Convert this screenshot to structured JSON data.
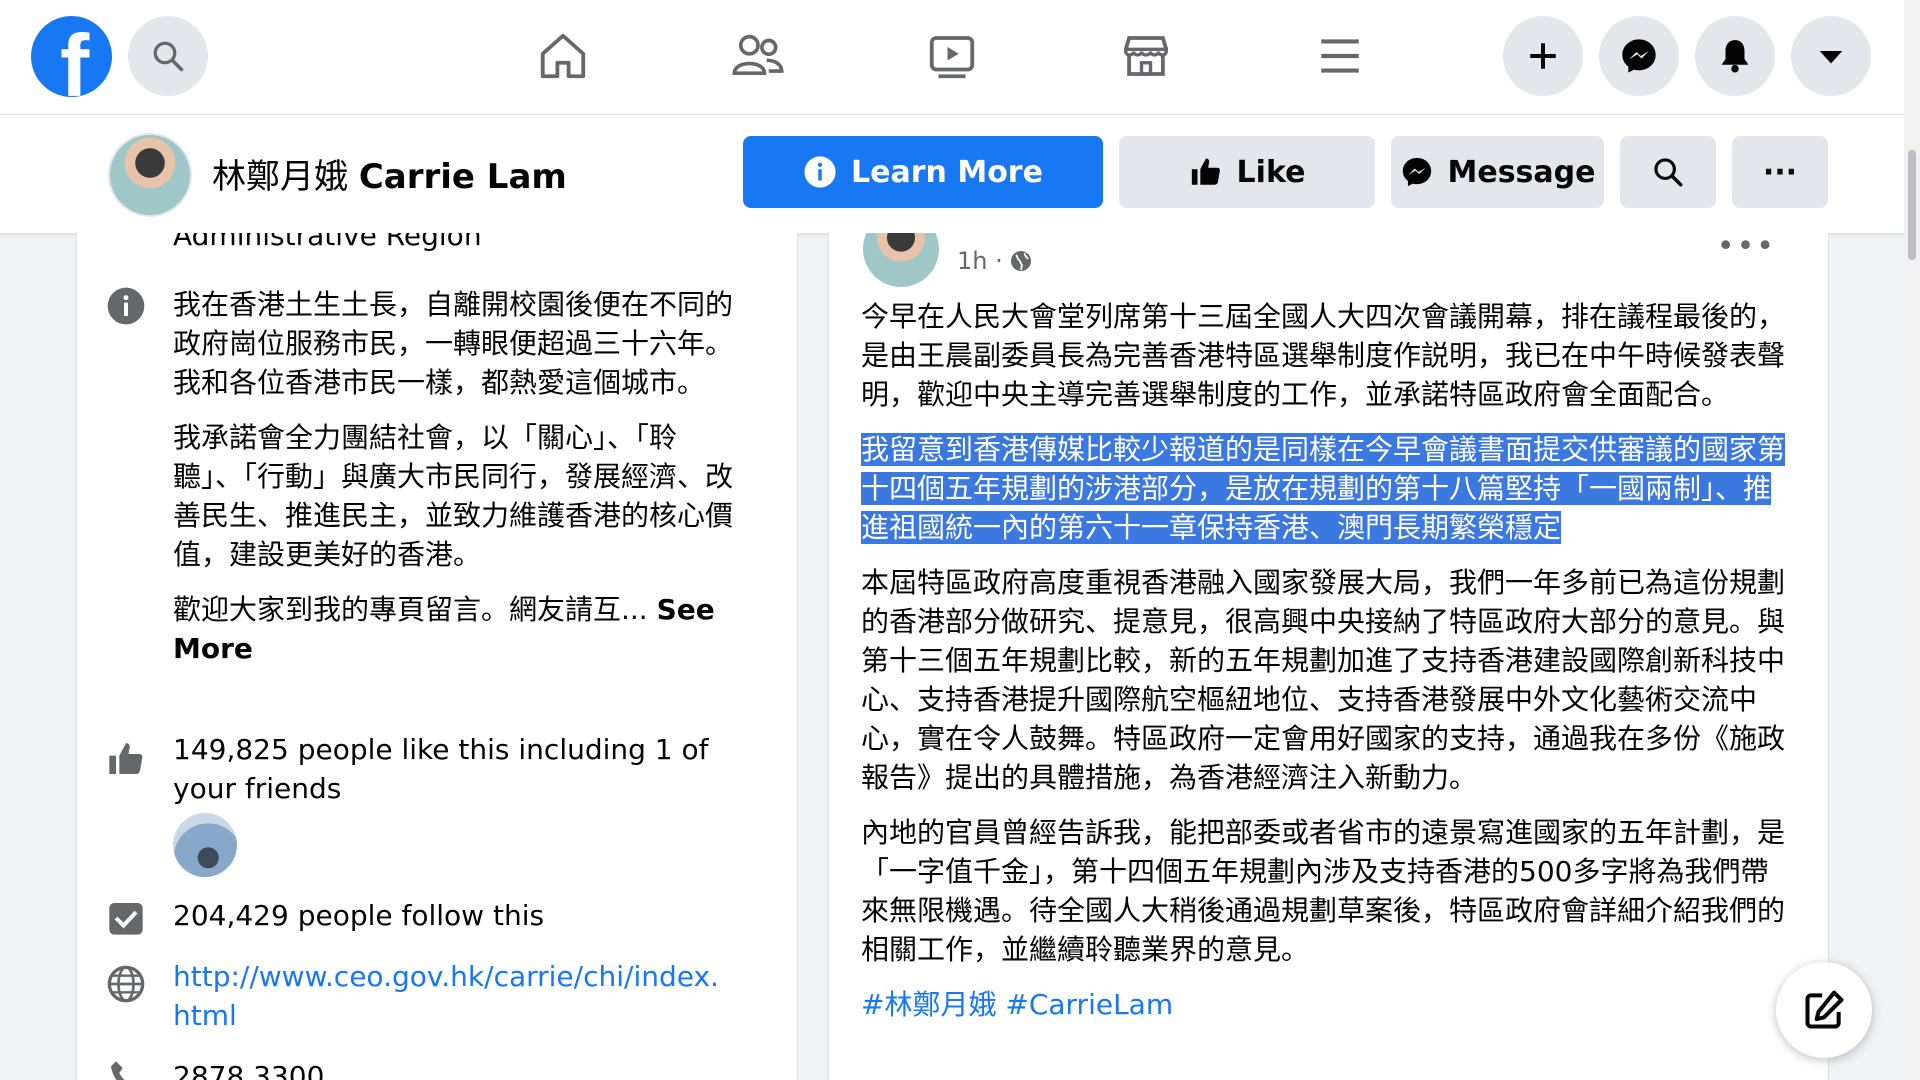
{
  "nav": {
    "logo_letter": "f",
    "icons": [
      "search-icon",
      "home-icon",
      "friends-icon",
      "watch-icon",
      "marketplace-icon",
      "menu-icon",
      "plus-icon",
      "messenger-icon",
      "notifications-icon",
      "account-dropdown-icon"
    ]
  },
  "page": {
    "name_zh": "林鄭月娥",
    "name_en": "Carrie Lam",
    "learn_more": "Learn More",
    "like": "Like",
    "message": "Message",
    "more": "···"
  },
  "intro": {
    "region_line": "Administrative Region",
    "about_p1": "我在香港土生土長，自離開校園後便在不同的政府崗位服務市民，一轉眼便超過三十六年。我和各位香港市民一樣，都熱愛這個城市。",
    "about_p2": "我承諾會全力團結社會，以「關心」、「聆聽」、「行動」與廣大市民同行，發展經濟、改善民生、推進民主，並致力維護香港的核心價值，建設更美好的香港。",
    "about_p3": "歡迎大家到我的專頁留言。網友請互...",
    "see_more": "See More",
    "likes": "149,825 people like this including 1 of your friends",
    "follows": "204,429 people follow this",
    "website": "http://www.ceo.gov.hk/carrie/chi/index.html",
    "phone": "2878 3300"
  },
  "post": {
    "time": "1h ·",
    "more": "•••",
    "p1": "今早在人民大會堂列席第十三屆全國人大四次會議開幕，排在議程最後的，是由王晨副委員長為完善香港特區選舉制度作説明，我已在中午時候發表聲明，歡迎中央主導完善選舉制度的工作，並承諾特區政府會全面配合。",
    "p2": "我留意到香港傳媒比較少報道的是同樣在今早會議書面提交供審議的國家第十四個五年規劃的涉港部分，是放在規劃的第十八篇堅持「一國兩制」、推進祖國統一內的第六十一章保持香港、澳門長期繁榮穩定",
    "p3": "本屆特區政府高度重視香港融入國家發展大局，我們一年多前已為這份規劃的香港部分做研究、提意見，很高興中央接納了特區政府大部分的意見。與第十三個五年規劃比較，新的五年規劃加進了支持香港建設國際創新科技中心、支持香港提升國際航空樞紐地位、支持香港發展中外文化藝術交流中心，實在令人鼓舞。特區政府一定會用好國家的支持，通過我在多份《施政報告》提出的具體措施，為香港經濟注入新動力。",
    "p4": "內地的官員曾經告訴我，能把部委或者省市的遠景寫進國家的五年計劃，是「一字值千金」，第十四個五年規劃內涉及支持香港的500多字將為我們帶來無限機遇。待全國人大稍後通過規劃草案後，特區政府會詳細介紹我們的相關工作，並繼續聆聽業界的意見。",
    "hashtags": "#林鄭月娥 #CarrieLam"
  },
  "colors": {
    "brand": "#1877f2",
    "selection": "#3b78e0"
  }
}
